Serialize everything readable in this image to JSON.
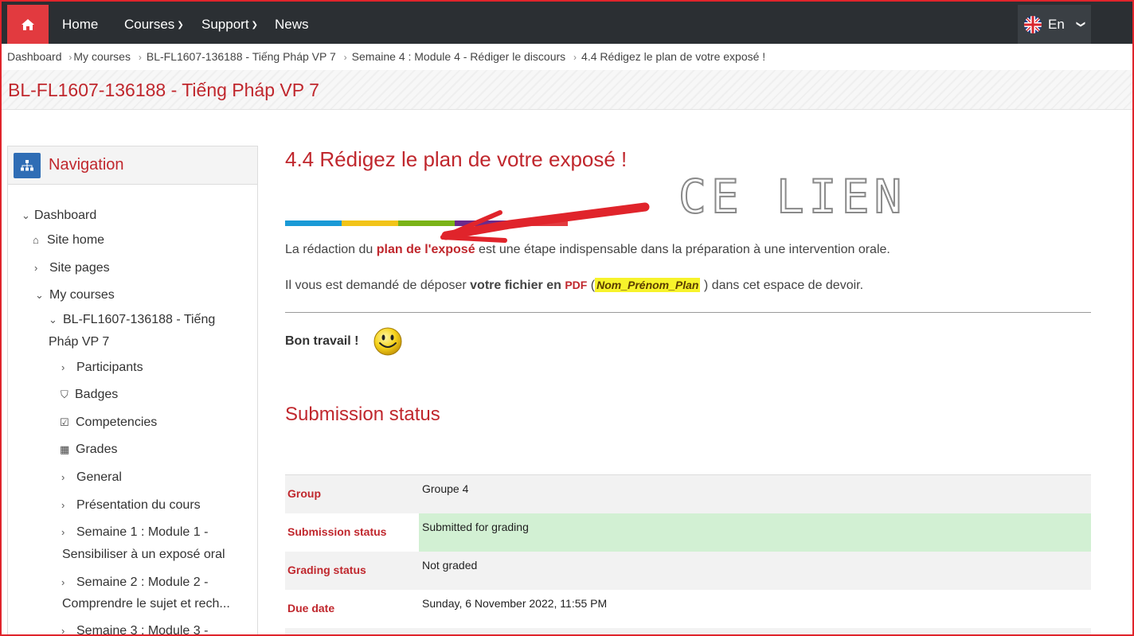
{
  "topbar": {
    "home_icon": "home-icon",
    "nav": [
      {
        "label": "Home"
      },
      {
        "label": "Courses",
        "dropdown": true
      },
      {
        "label": "Support",
        "dropdown": true
      },
      {
        "label": "News"
      }
    ],
    "language": {
      "label": "En",
      "flag": "uk-flag-icon"
    }
  },
  "breadcrumb": [
    "Dashboard",
    "My courses",
    "BL-FL1607-136188 - Tiếng Pháp VP 7",
    "Semaine 4 : Module 4 - Rédiger le discours",
    "4.4 Rédigez le plan de votre exposé !"
  ],
  "course_title": "BL-FL1607-136188 - Tiếng Pháp VP 7",
  "navigation": {
    "title": "Navigation",
    "items": [
      {
        "label": "Dashboard"
      },
      {
        "label": "Site home"
      },
      {
        "label": "Site pages"
      },
      {
        "label": "My courses"
      },
      {
        "label_line1": "BL-FL1607-136188 - Tiếng",
        "label_line2": "Pháp VP 7"
      },
      {
        "label": "Participants"
      },
      {
        "label": "Badges"
      },
      {
        "label": "Competencies"
      },
      {
        "label": "Grades"
      },
      {
        "label": "General"
      },
      {
        "label": "Présentation du cours"
      },
      {
        "label_line1": "Semaine 1 : Module 1 -",
        "label_line2": "Sensibiliser à un exposé oral"
      },
      {
        "label_line1": "Semaine 2 : Module 2 -",
        "label_line2": "Comprendre le sujet et rech..."
      },
      {
        "label": "Semaine 3 : Module 3 -"
      }
    ]
  },
  "main": {
    "title": "4.4 Rédigez le plan de votre exposé !",
    "colors": [
      "#1a9ad6",
      "#f2c418",
      "#7ab317",
      "#6b2a8c",
      "#e23a3f"
    ],
    "p1_before": "La rédaction du ",
    "p1_link": "plan de l'exposé",
    "p1_after": " est une étape indispensable dans la préparation à une intervention orale.",
    "p2_before": "Il vous est demandé de déposer ",
    "p2_bold": "votre fichier en",
    "p2_pdf": "PDF",
    "p2_open": " (",
    "p2_hl": "Nom_Prénom_Plan",
    "p2_close": " )",
    "p2_after": " dans cet espace de devoir.",
    "bon": "Bon travail !",
    "smiley": "smiley-icon",
    "annotation": "CE LIEN"
  },
  "submission": {
    "title": "Submission status",
    "rows": [
      {
        "key": "Group",
        "value": "Groupe 4"
      },
      {
        "key": "Submission status",
        "value": "Submitted for grading"
      },
      {
        "key": "Grading status",
        "value": "Not graded"
      },
      {
        "key": "Due date",
        "value": "Sunday, 6 November 2022, 11:55 PM"
      }
    ]
  }
}
